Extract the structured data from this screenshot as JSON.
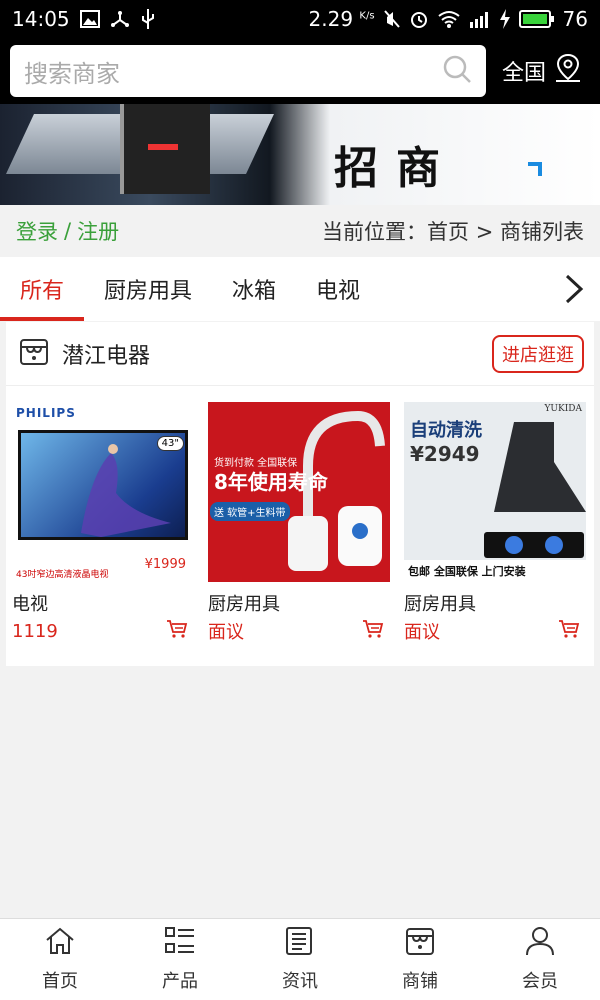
{
  "status_bar": {
    "time": "14:05",
    "speed": "2.29",
    "speed_unit": "K/s",
    "battery": "76"
  },
  "search": {
    "placeholder": "搜索商家",
    "region_label": "全国"
  },
  "banner": {
    "title": "招商"
  },
  "breadcrumb": {
    "login": "登录",
    "separator": "/",
    "register": "注册",
    "location": "当前位置：首页 > 商铺列表"
  },
  "tabs": [
    {
      "label": "所有",
      "active": true
    },
    {
      "label": "厨房用具",
      "active": false
    },
    {
      "label": "冰箱",
      "active": false
    },
    {
      "label": "电视",
      "active": false
    }
  ],
  "shop": {
    "name": "潜江电器",
    "visit_label": "进店逛逛",
    "products": [
      {
        "name": "电视",
        "price": "1119",
        "image": {
          "brand": "PHILIPS",
          "size_badge": "43\"",
          "caption": "43吋窄边高清液晶电视",
          "price_text": "¥1999"
        }
      },
      {
        "name": "厨房用具",
        "price": "面议",
        "image": {
          "line1": "货到付款 全国联保",
          "line2": "8年使用寿命",
          "band": "送 软管+生料带"
        }
      },
      {
        "name": "厨房用具",
        "price": "面议",
        "image": {
          "brand": "YUKIDA",
          "line1": "自动清洗",
          "line2": "¥2949",
          "footer": "包邮 全国联保 上门安装"
        }
      }
    ]
  },
  "bottom_nav": [
    {
      "label": "首页",
      "icon": "home-icon"
    },
    {
      "label": "产品",
      "icon": "list-icon"
    },
    {
      "label": "资讯",
      "icon": "news-icon"
    },
    {
      "label": "商铺",
      "icon": "store-icon"
    },
    {
      "label": "会员",
      "icon": "user-icon"
    }
  ],
  "colors": {
    "accent": "#d9261c",
    "login_green": "#3aa03a"
  }
}
